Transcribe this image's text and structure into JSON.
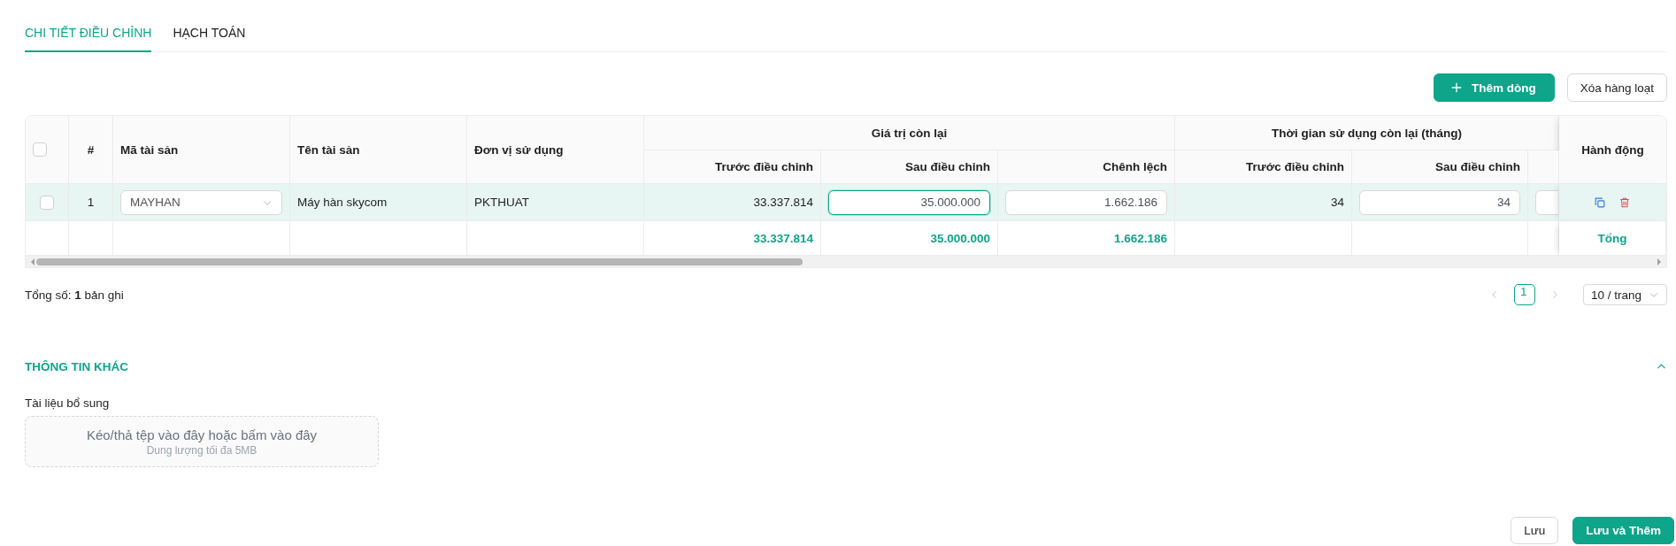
{
  "tabs": [
    {
      "label": "CHI TIẾT ĐIỀU CHỈNH",
      "selected": true
    },
    {
      "label": "HẠCH TOÁN",
      "selected": false
    }
  ],
  "toolbar": {
    "add_button": {
      "label": "Thêm dòng"
    },
    "bulk_delete_button": {
      "label": "Xóa hàng loạt"
    }
  },
  "table": {
    "columns": [
      {
        "kind": "checkbox",
        "checked": false
      },
      {
        "kind": "index",
        "label": "#"
      },
      {
        "kind": "single",
        "label": "Mã tài sản"
      },
      {
        "kind": "single",
        "label": "Tên tài sản"
      },
      {
        "kind": "single",
        "label": "Đơn vị sử dụng"
      },
      {
        "kind": "sub",
        "group": "Giá trị còn lại",
        "label": "Trước điều chỉnh"
      },
      {
        "kind": "sub",
        "label": "Sau điều chỉnh"
      },
      {
        "kind": "sub",
        "label": "Chênh lệch"
      },
      {
        "kind": "sub",
        "group": "Thời gian sử dụng còn lại (tháng)",
        "label": "Trước điều chỉnh"
      },
      {
        "kind": "sub",
        "label": "Sau điều chỉnh"
      },
      {
        "kind": "cut"
      },
      {
        "kind": "actions",
        "label": "Hành động"
      }
    ],
    "rows": [
      {
        "highlighted": true,
        "cells": [
          {
            "kind": "checkbox",
            "checked": false
          },
          {
            "kind": "index",
            "text": "1"
          },
          {
            "kind": "select",
            "value": "MAYHAN"
          },
          {
            "kind": "text",
            "text": "Máy hàn skycom"
          },
          {
            "kind": "text",
            "text": "PKTHUAT"
          },
          {
            "kind": "number",
            "text": "33.337.814"
          },
          {
            "kind": "input",
            "value": "35.000.000",
            "focused": true
          },
          {
            "kind": "input",
            "value": "1.662.186",
            "focused": false
          },
          {
            "kind": "number",
            "text": "34"
          },
          {
            "kind": "input",
            "value": "34",
            "focused": false
          },
          {
            "kind": "cut_input"
          },
          {
            "kind": "actions"
          }
        ]
      }
    ],
    "summary": [
      {
        "kind": "empty"
      },
      {
        "kind": "empty"
      },
      {
        "kind": "empty"
      },
      {
        "kind": "empty"
      },
      {
        "kind": "empty"
      },
      {
        "kind": "number",
        "text": "33.337.814"
      },
      {
        "kind": "number",
        "text": "35.000.000"
      },
      {
        "kind": "number",
        "text": "1.662.186"
      },
      {
        "kind": "empty"
      },
      {
        "kind": "empty"
      },
      {
        "kind": "empty"
      },
      {
        "kind": "label",
        "text": "Tổng"
      }
    ]
  },
  "total": "Tổng số: **1** bản ghi",
  "pagination": {
    "pages": [
      {
        "label": "1",
        "selected": true
      }
    ],
    "page_size": "10 / trang"
  },
  "section": {
    "title": "THÔNG TIN KHÁC",
    "expanded": true,
    "field_label": "Tài liệu bổ sung",
    "dropzone": {
      "text": "Kéo/thả tệp vào đây hoặc bấm vào đây",
      "hint": "Dung lượng tối đa 5MB"
    }
  },
  "footer": {
    "buttons": [
      {
        "label": "Lưu",
        "kind": "default"
      },
      {
        "label": "Lưu và Thêm",
        "kind": "primary"
      }
    ]
  }
}
